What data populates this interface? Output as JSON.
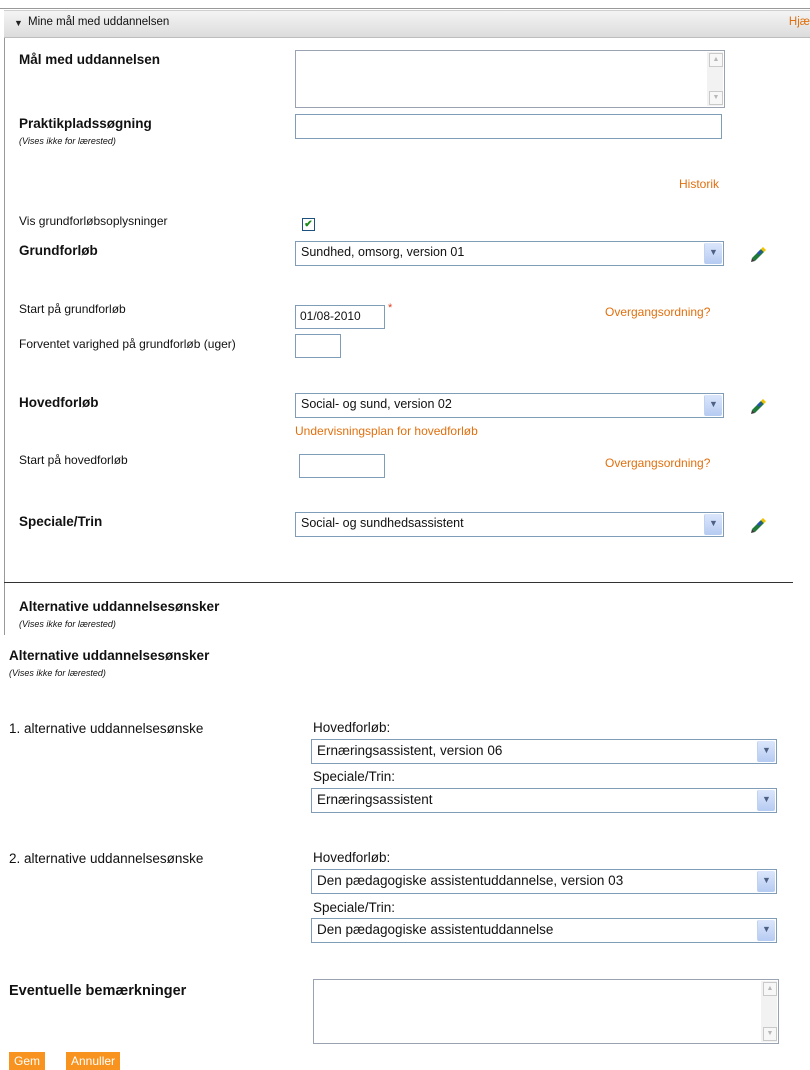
{
  "header": {
    "title": "Mine mål med uddannelsen",
    "help": "Hjæ"
  },
  "goal": {
    "label": "Mål med uddannelsen",
    "value": ""
  },
  "praktik": {
    "label": "Praktikpladssøgning",
    "note": "(Vises ikke for lærested)",
    "value": ""
  },
  "history_link": "Historik",
  "show_basic": {
    "label": "Vis grundforløbsoplysninger",
    "checked": true,
    "mark": "✔"
  },
  "grundforloeb": {
    "label": "Grundforløb",
    "selected": "Sundhed, omsorg, version 01"
  },
  "start_grund": {
    "label": "Start på grundforløb",
    "value": "01/08-2010",
    "required": "*",
    "transition_link": "Overgangsordning?"
  },
  "duration": {
    "label": "Forventet varighed på grundforløb (uger)",
    "value": ""
  },
  "hovedforloeb": {
    "label": "Hovedforløb",
    "selected": "Social- og sund, version 02",
    "plan_link": "Undervisningsplan for hovedforløb"
  },
  "start_hoved": {
    "label": "Start på hovedforløb",
    "value": "",
    "transition_link": "Overgangsordning?"
  },
  "speciale": {
    "label": "Speciale/Trin",
    "selected": "Social- og sundhedsassistent"
  },
  "alt_section": {
    "title": "Alternative uddannelsesønsker",
    "note": "(Vises ikke for lærested)"
  },
  "alt_section2": {
    "title": "Alternative uddannelsesønsker",
    "note": "(Vises ikke for lærested)"
  },
  "alt1": {
    "label": "1. alternative uddannelsesønske",
    "hoved_label": "Hovedforløb:",
    "hoved_selected": "Ernæringsassistent, version 06",
    "spec_label": "Speciale/Trin:",
    "spec_selected": "Ernæringsassistent"
  },
  "alt2": {
    "label": "2. alternative uddannelsesønske",
    "hoved_label": "Hovedforløb:",
    "hoved_selected": "Den pædagogiske assistentuddannelse, version 03",
    "spec_label": "Speciale/Trin:",
    "spec_selected": "Den pædagogiske assistentuddannelse"
  },
  "remarks": {
    "label": "Eventuelle bemærkninger",
    "value": ""
  },
  "buttons": {
    "save": "Gem",
    "cancel": "Annuller"
  },
  "colors": {
    "link": "#e0700f",
    "button": "#f7931e"
  }
}
